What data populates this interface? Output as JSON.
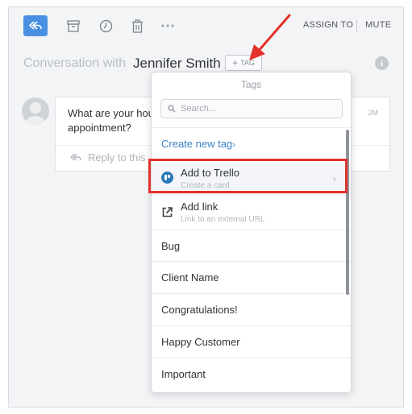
{
  "toolbar": {
    "reply_icon": "reply-all-icon",
    "archive_icon": "archive-icon",
    "snooze_icon": "clock-icon",
    "delete_icon": "trash-icon",
    "more_icon": "more-horizontal-icon",
    "assign_label": "ASSIGN TO",
    "mute_label": "MUTE"
  },
  "conversation": {
    "prefix": "Conversation with",
    "contact_name": "Jennifer Smith",
    "tag_button_label": "TAG",
    "info_icon": "info-icon"
  },
  "message": {
    "text": "What are your hou appointment?",
    "time": "2M",
    "reply_placeholder": "Reply to this"
  },
  "tags_dropdown": {
    "title": "Tags",
    "search_placeholder": "Search...",
    "create_new_label": "Create new tag",
    "actions": [
      {
        "title": "Add to Trello",
        "subtitle": "Create a card",
        "icon": "trello-icon"
      },
      {
        "title": "Add link",
        "subtitle": "Link to an external URL",
        "icon": "external-link-icon"
      }
    ],
    "tags": [
      "Bug",
      "Client Name",
      "Congratulations!",
      "Happy Customer",
      "Important"
    ]
  },
  "colors": {
    "accent": "#4a90e2",
    "link": "#3a82c4",
    "highlight_border": "#e2322b",
    "trello": "#2a7ab8"
  }
}
